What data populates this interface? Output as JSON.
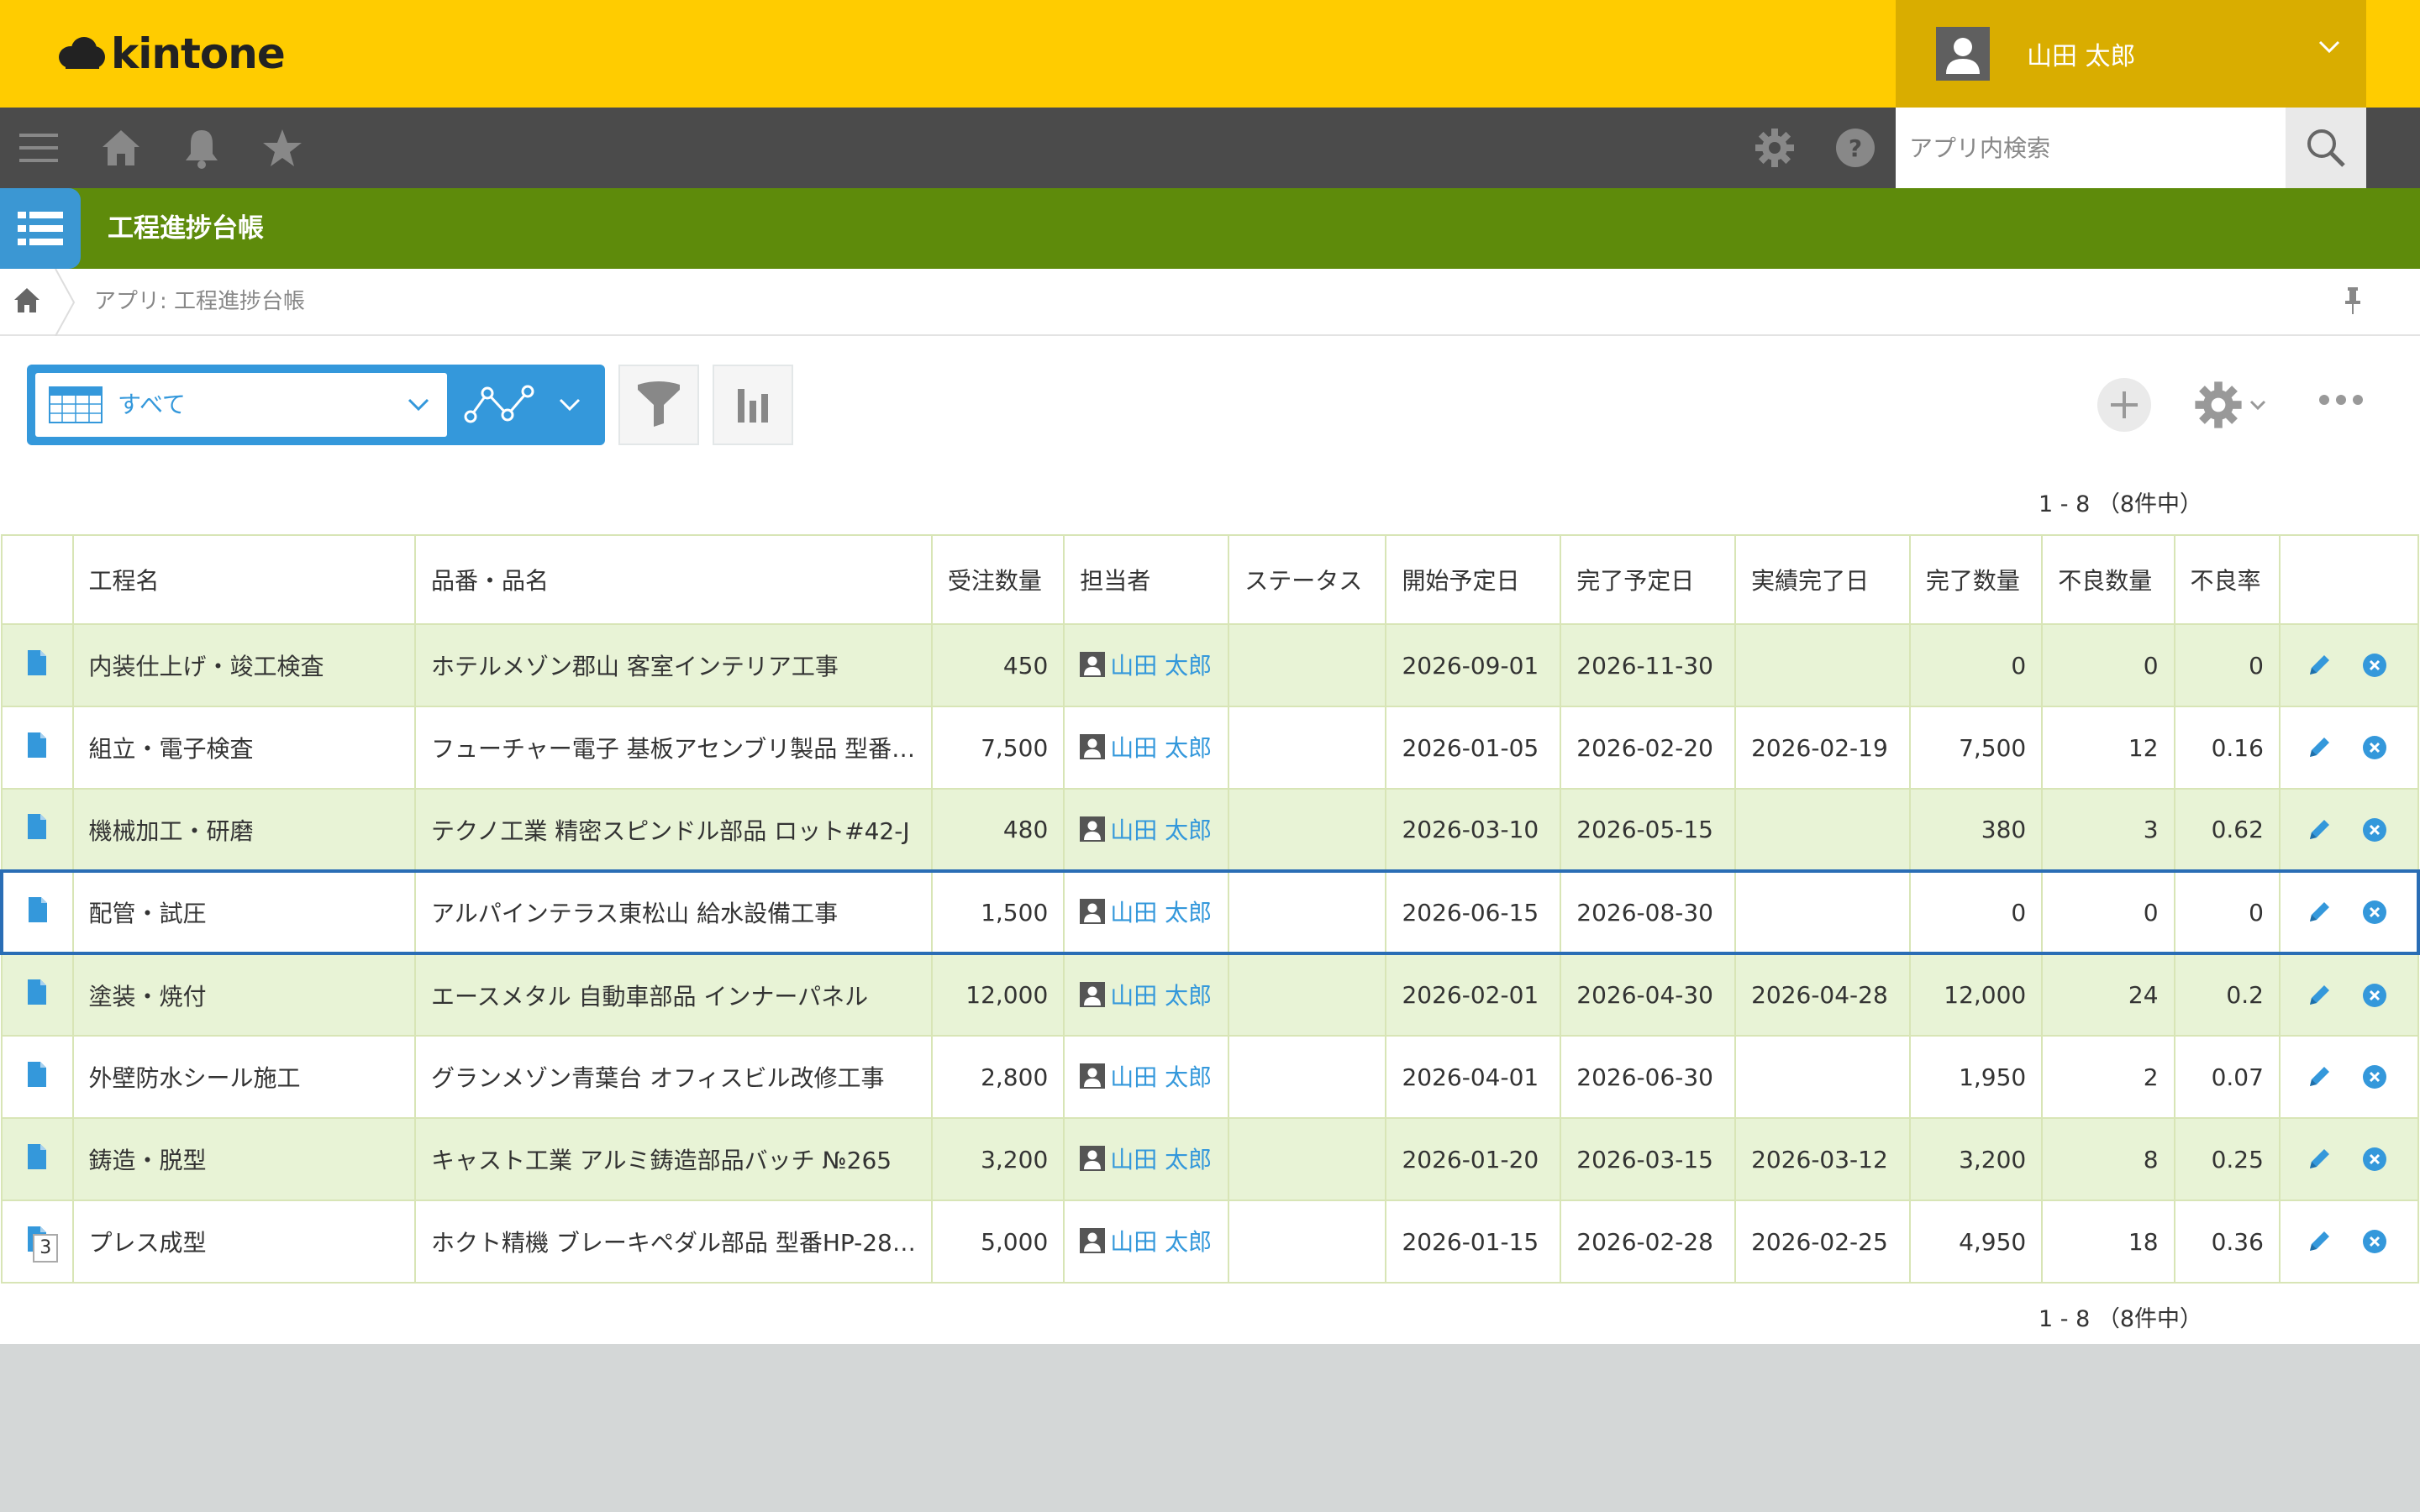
{
  "brand": {
    "logo_text": "kintone"
  },
  "user": {
    "name": "山田 太郎"
  },
  "nav": {
    "icons": [
      "menu-icon",
      "home-icon",
      "bell-icon",
      "star-icon",
      "gear-icon",
      "help-icon"
    ],
    "search_placeholder": "アプリ内検索"
  },
  "app": {
    "title": "工程進捗台帳",
    "breadcrumb": "アプリ: 工程進捗台帳"
  },
  "toolbar": {
    "view_label": "すべて"
  },
  "pager": {
    "top": "1 - 8 （8件中）",
    "bottom": "1 - 8 （8件中）"
  },
  "table": {
    "columns": [
      "工程名",
      "品番・品名",
      "受注数量",
      "担当者",
      "ステータス",
      "開始予定日",
      "完了予定日",
      "実績完了日",
      "完了数量",
      "不良数量",
      "不良率"
    ],
    "rows": [
      {
        "process": "内装仕上げ・竣工検査",
        "item": "ホテルメゾン郡山 客室インテリア工事",
        "qty": "450",
        "owner": "山田 太郎",
        "status": "",
        "start": "2026-09-01",
        "due": "2026-11-30",
        "actual": "",
        "done": "0",
        "defects": "0",
        "rate": "0"
      },
      {
        "process": "組立・電子検査",
        "item": "フューチャー電子 基板アセンブリ製品 型番…",
        "qty": "7,500",
        "owner": "山田 太郎",
        "status": "",
        "start": "2026-01-05",
        "due": "2026-02-20",
        "actual": "2026-02-19",
        "done": "7,500",
        "defects": "12",
        "rate": "0.16"
      },
      {
        "process": "機械加工・研磨",
        "item": "テクノ工業 精密スピンドル部品 ロット#42-J",
        "qty": "480",
        "owner": "山田 太郎",
        "status": "",
        "start": "2026-03-10",
        "due": "2026-05-15",
        "actual": "",
        "done": "380",
        "defects": "3",
        "rate": "0.62"
      },
      {
        "process": "配管・試圧",
        "item": "アルパインテラス東松山 給水設備工事",
        "qty": "1,500",
        "owner": "山田 太郎",
        "status": "",
        "start": "2026-06-15",
        "due": "2026-08-30",
        "actual": "",
        "done": "0",
        "defects": "0",
        "rate": "0"
      },
      {
        "process": "塗装・焼付",
        "item": "エースメタル 自動車部品 インナーパネル",
        "qty": "12,000",
        "owner": "山田 太郎",
        "status": "",
        "start": "2026-02-01",
        "due": "2026-04-30",
        "actual": "2026-04-28",
        "done": "12,000",
        "defects": "24",
        "rate": "0.2"
      },
      {
        "process": "外壁防水シール施工",
        "item": "グランメゾン青葉台 オフィスビル改修工事",
        "qty": "2,800",
        "owner": "山田 太郎",
        "status": "",
        "start": "2026-04-01",
        "due": "2026-06-30",
        "actual": "",
        "done": "1,950",
        "defects": "2",
        "rate": "0.07"
      },
      {
        "process": "鋳造・脱型",
        "item": "キャスト工業 アルミ鋳造部品バッチ №265",
        "qty": "3,200",
        "owner": "山田 太郎",
        "status": "",
        "start": "2026-01-20",
        "due": "2026-03-15",
        "actual": "2026-03-12",
        "done": "3,200",
        "defects": "8",
        "rate": "0.25"
      },
      {
        "process": "プレス成型",
        "item": "ホクト精機 ブレーキペダル部品 型番HP-28…",
        "qty": "5,000",
        "owner": "山田 太郎",
        "status": "",
        "start": "2026-01-15",
        "due": "2026-02-28",
        "actual": "2026-02-25",
        "done": "4,950",
        "defects": "18",
        "rate": "0.36",
        "comment_count": "3"
      }
    ]
  }
}
